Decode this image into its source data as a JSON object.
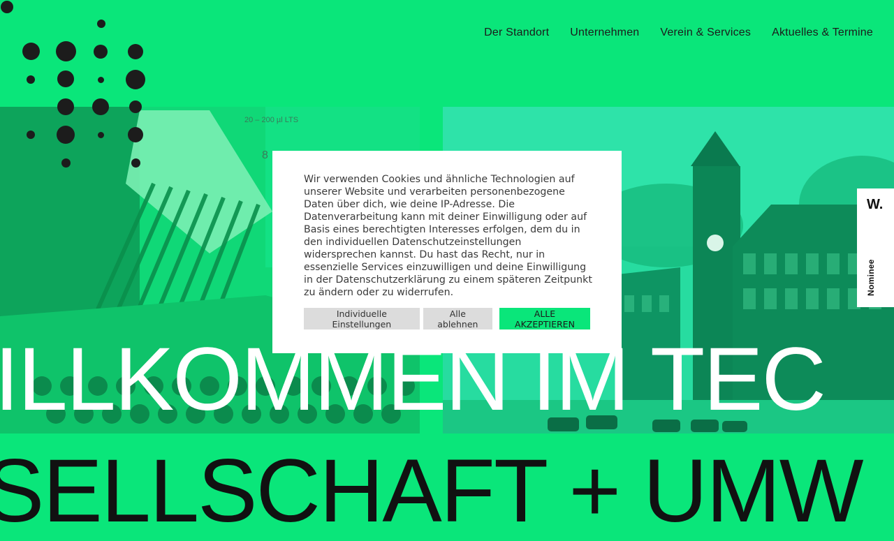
{
  "nav": {
    "items": [
      "Der Standort",
      "Unternehmen",
      "Verein & Services",
      "Aktuelles & Termine"
    ]
  },
  "hero": {
    "headline": "ILLKOMMEN IM TEC",
    "subheadline": "SELLSCHAFT + UMW"
  },
  "cookie": {
    "text": "Wir verwenden Cookies und ähnliche Technologien auf unserer Website und verarbeiten personenbezogene Daten über dich, wie deine IP-Adresse. Die Datenverarbeitung kann mit deiner Einwilligung oder auf Basis eines berechtigten Interesses erfolgen, dem du in den individuellen Datenschutzeinstellungen widersprechen kannst. Du hast das Recht, nur in essenzielle Services einzuwilligen und deine Einwilligung in der Datenschutzerklärung zu einem späteren Zeitpunkt zu ändern oder zu widerrufen.",
    "btn_settings": "Individuelle Einstellungen",
    "btn_reject": "Alle ablehnen",
    "btn_accept": "ALLE AKZEPTIEREN"
  },
  "award": {
    "logo": "W.",
    "label": "Nominee"
  },
  "photo_left_labels": [
    "20 – 200 µl LTS",
    "8"
  ],
  "colors": {
    "accent": "#0ae67a",
    "dark": "#1b1b1b"
  }
}
